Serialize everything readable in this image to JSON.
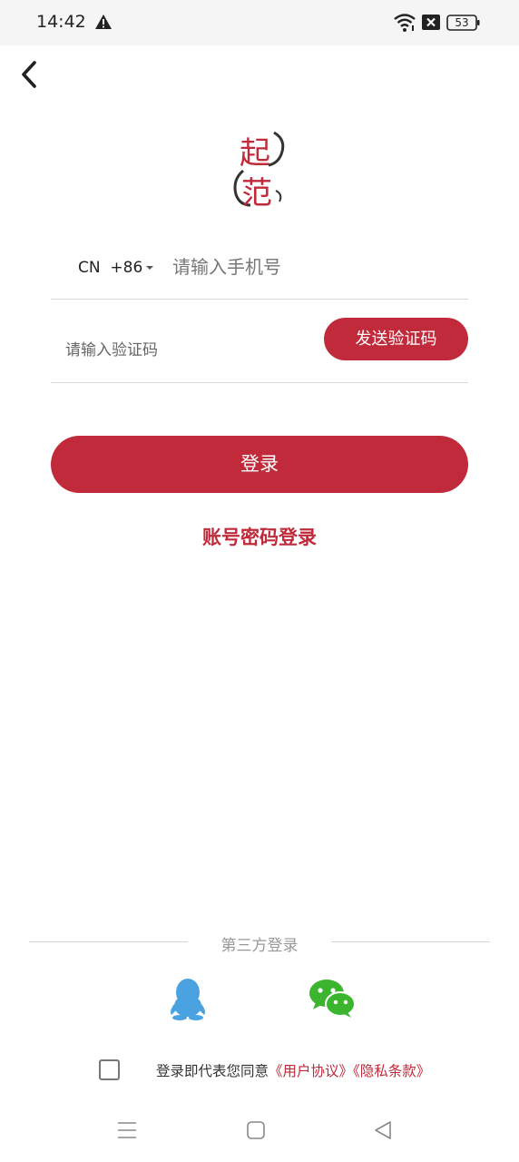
{
  "status_bar": {
    "time": "14:42",
    "battery": "53",
    "icons": [
      "warning-icon",
      "wifi-icon",
      "no-sim-icon",
      "battery-icon"
    ]
  },
  "header": {
    "back_icon": "chevron-left-icon"
  },
  "logo": {
    "icon": "qifan-logo",
    "chars": [
      "起",
      "范"
    ]
  },
  "form": {
    "country_code": "CN  +86",
    "phone_placeholder": "请输入手机号",
    "code_placeholder": "请输入验证码",
    "send_code_label": "发送验证码",
    "login_label": "登录",
    "password_login_label": "账号密码登录"
  },
  "third_party": {
    "title": "第三方登录",
    "providers": [
      {
        "name": "QQ",
        "icon": "qq-icon"
      },
      {
        "name": "WeChat",
        "icon": "wechat-icon"
      }
    ]
  },
  "agreement": {
    "checked": false,
    "prefix": "登录即代表您同意",
    "user_agreement": "《用户协议》",
    "privacy_policy": "《隐私条款》"
  },
  "navbar": {
    "icons": [
      "menu-icon",
      "home-icon",
      "back-triangle-icon"
    ]
  },
  "colors": {
    "accent": "#c12a3a",
    "qq": "#4aa3e0",
    "wechat": "#3bb52e"
  }
}
